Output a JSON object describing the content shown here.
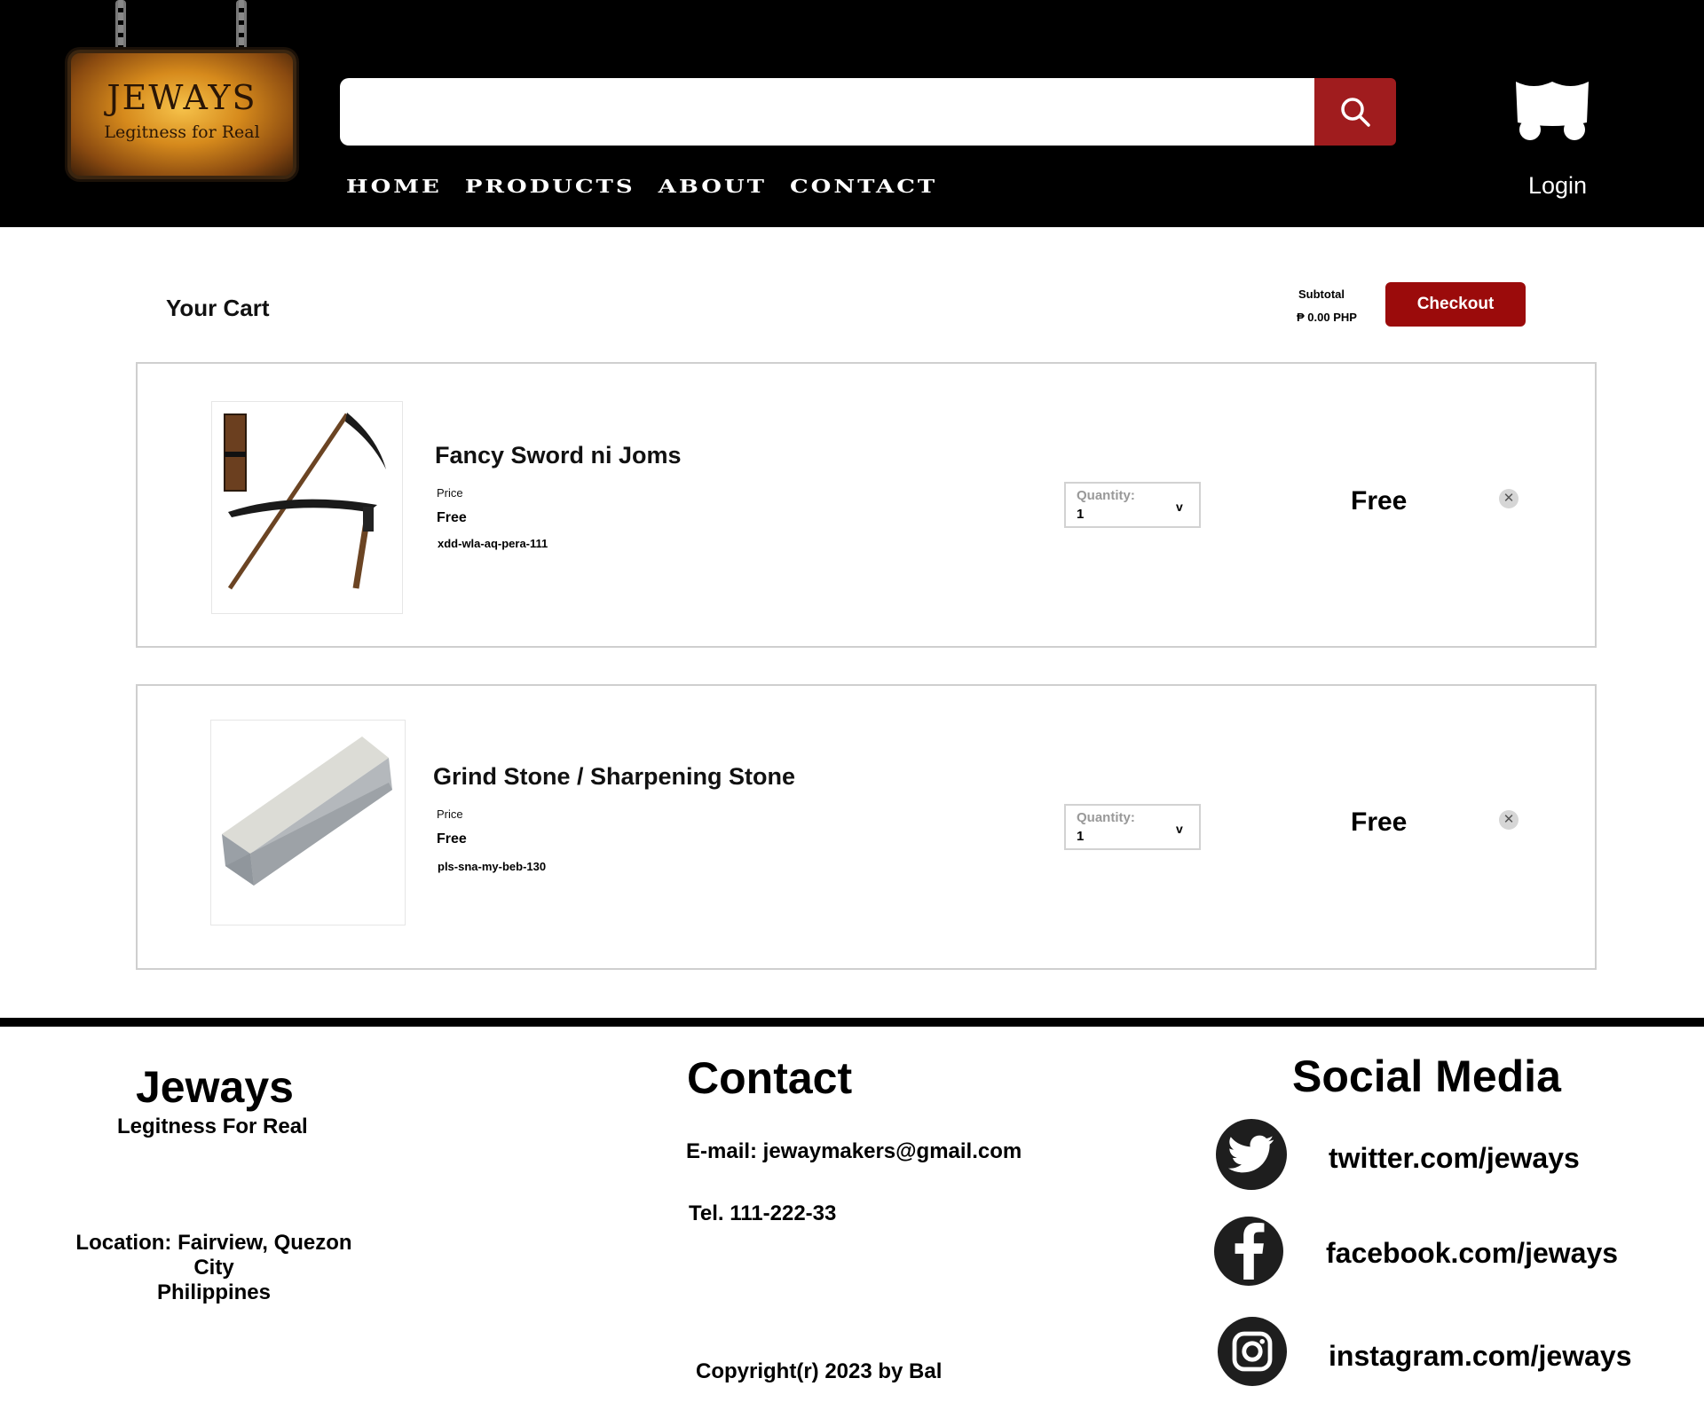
{
  "header": {
    "logo": {
      "title": "JEWAYS",
      "tagline": "Legitness for Real"
    },
    "search": {
      "placeholder": "",
      "value": ""
    },
    "nav": [
      "HOME",
      "PRODUCTS",
      "ABOUT",
      "CONTACT"
    ],
    "login_label": "Login"
  },
  "cart": {
    "title": "Your Cart",
    "subtotal_label": "Subtotal",
    "subtotal_value": "₱ 0.00 PHP",
    "checkout_label": "Checkout",
    "items": [
      {
        "name": "Fancy Sword ni Joms",
        "price_label": "Price",
        "price": "Free",
        "sku": "xdd-wla-aq-pera-111",
        "quantity_label": "Quantity:",
        "quantity": "1",
        "quantity_arrow": "v",
        "total": "Free",
        "image": "scythe"
      },
      {
        "name": "Grind Stone / Sharpening Stone",
        "price_label": "Price",
        "price": "Free",
        "sku": "pls-sna-my-beb-130",
        "quantity_label": "Quantity:",
        "quantity": "1",
        "quantity_arrow": "v",
        "total": "Free",
        "image": "sharpening-stone"
      }
    ]
  },
  "footer": {
    "brand": "Jeways",
    "tagline": "Legitness For Real",
    "location_line1": "Location: Fairview, Quezon City",
    "location_line2": "Philippines",
    "contact_title": "Contact",
    "email": "E-mail: jewaymakers@gmail.com",
    "tel": "Tel. 111-222-33",
    "copyright": "Copyright(r) 2023 by Bal",
    "social_title": "Social Media",
    "social": [
      {
        "icon": "twitter-icon",
        "label": "twitter.com/jeways"
      },
      {
        "icon": "facebook-icon",
        "label": "facebook.com/jeways"
      },
      {
        "icon": "instagram-icon",
        "label": "instagram.com/jeways"
      }
    ]
  },
  "colors": {
    "accent": "#9b0b0b",
    "search_button": "#a01c1e",
    "header_bg": "#000000"
  }
}
